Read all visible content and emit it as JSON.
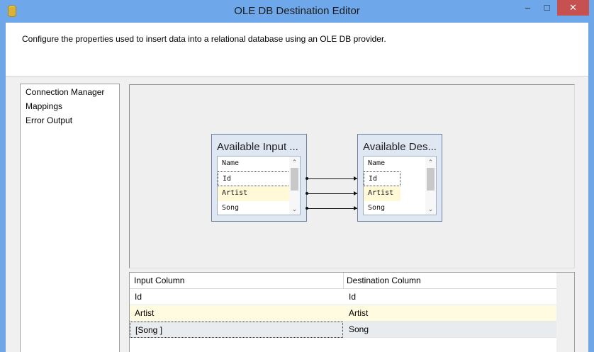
{
  "window": {
    "title": "OLE DB Destination Editor",
    "min": "–",
    "max": "□",
    "close": "✕"
  },
  "header": {
    "description": "Configure the properties used to insert data into a relational database using an OLE DB provider."
  },
  "nav": {
    "items": [
      {
        "label": "Connection Manager"
      },
      {
        "label": "Mappings"
      },
      {
        "label": "Error Output"
      }
    ]
  },
  "mapping": {
    "input_box": {
      "title": "Available Input ...",
      "header": "Name",
      "items": [
        "Id",
        "Artist",
        "Song"
      ]
    },
    "dest_box": {
      "title": "Available Des...",
      "header": "Name",
      "items": [
        "Id",
        "Artist",
        "Song"
      ]
    },
    "scroll_up": "⌃",
    "scroll_down": "⌄"
  },
  "grid": {
    "headers": [
      "Input Column",
      "Destination Column"
    ],
    "rows": [
      [
        "Id",
        "Id"
      ],
      [
        "Artist",
        "Artist"
      ],
      [
        "[Song ]",
        "Song"
      ]
    ]
  },
  "colors": {
    "titlebar": "#6fa8ea",
    "close": "#c75050",
    "highlight": "#fff9d8"
  },
  "icons": [
    "database-icon"
  ]
}
